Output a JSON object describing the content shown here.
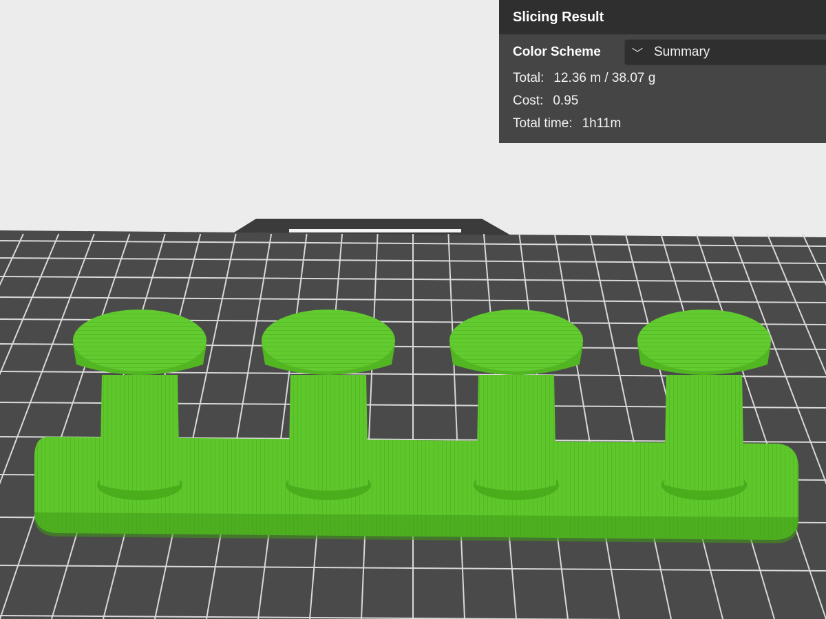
{
  "panel": {
    "title": "Slicing Result",
    "color_scheme_label": "Color Scheme",
    "color_scheme_value": "Summary",
    "stats": {
      "total_label": "Total:",
      "total_value": "12.36 m / 38.07 g",
      "cost_label": "Cost:",
      "cost_value": "0.95",
      "time_label": "Total time:",
      "time_value": "1h11m"
    }
  },
  "scene": {
    "plate_color": "#4a4a4a",
    "grid_color": "#d8d8d8",
    "model_color": "#5fc52a",
    "model_dark": "#3f9a18",
    "background": "#ececec",
    "pegs": 4
  }
}
